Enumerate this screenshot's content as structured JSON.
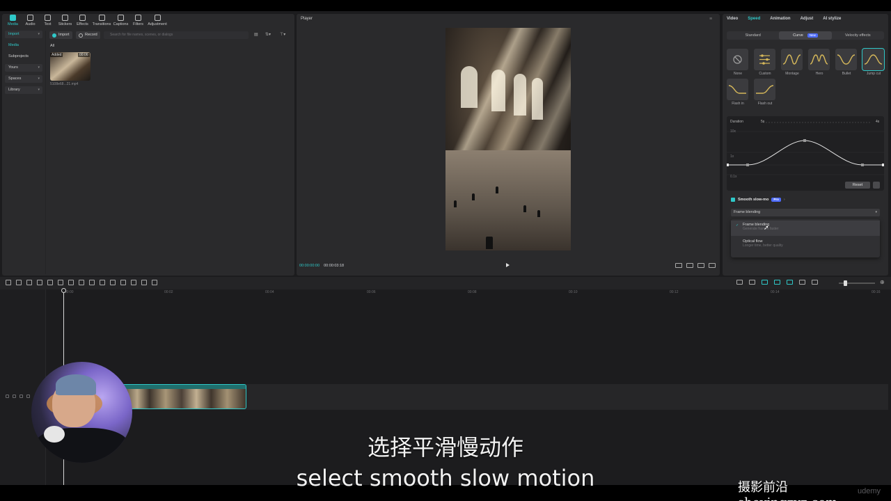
{
  "toolbar": {
    "items": [
      "Media",
      "Audio",
      "Text",
      "Stickers",
      "Effects",
      "Transitions",
      "Captions",
      "Filters",
      "Adjustment"
    ],
    "active_index": 0
  },
  "media": {
    "nav": {
      "import": "Import",
      "media": "Media",
      "subprojects": "Subprojects",
      "yours": "Yours",
      "spaces": "Spaces",
      "library": "Library"
    },
    "import_btn": "Import",
    "record_btn": "Record",
    "search_placeholder": "Search for file names, scenes, or dialogs",
    "filter_all": "All",
    "asset": {
      "tag": "Added",
      "duration": "00:06",
      "name": "5108e68...21.mp4"
    }
  },
  "player": {
    "title": "Player",
    "current_time": "00:00:00:00",
    "total_time": "00:00:03:18"
  },
  "properties": {
    "tabs": [
      "Video",
      "Speed",
      "Animation",
      "Adjust",
      "AI stylize"
    ],
    "active_tab": "Speed",
    "speed_modes": [
      "Standard",
      "Curve",
      "Velocity effects"
    ],
    "active_mode": "Curve",
    "new_badge": "New",
    "presets": [
      "None",
      "Custom",
      "Montage",
      "Hero",
      "Bullet",
      "Jump cut",
      "Flash in",
      "Flash out"
    ],
    "selected_preset": "Jump cut",
    "curve": {
      "duration_label": "Duration",
      "duration_start": "5s",
      "duration_end": "4s",
      "y_top": "10x",
      "y_mid": "1x",
      "y_bottom": "0.1x",
      "reset": "Reset"
    },
    "smooth_slowmo": {
      "label": "Smooth slow-mo",
      "badge": "Pro",
      "selected": "Frame blending",
      "options": [
        {
          "title": "Frame blending",
          "sub": "Generate frames faster"
        },
        {
          "title": "Optical flow",
          "sub": "Longer time, better quality"
        }
      ]
    }
  },
  "timeline": {
    "ticks": [
      "00:00",
      "00:02",
      "00:04",
      "00:06",
      "00:08",
      "00:10",
      "00:12",
      "00:14",
      "00:16"
    ]
  },
  "overlay": {
    "subtitle_cn": "选择平滑慢动作",
    "subtitle_en": "select smooth slow motion",
    "watermark": "摄影前沿 sheyingzyz.com",
    "brand": "udemy"
  },
  "colors": {
    "accent": "#2fc8c8",
    "badge": "#4e6cff",
    "panel": "#2a2a2c"
  }
}
